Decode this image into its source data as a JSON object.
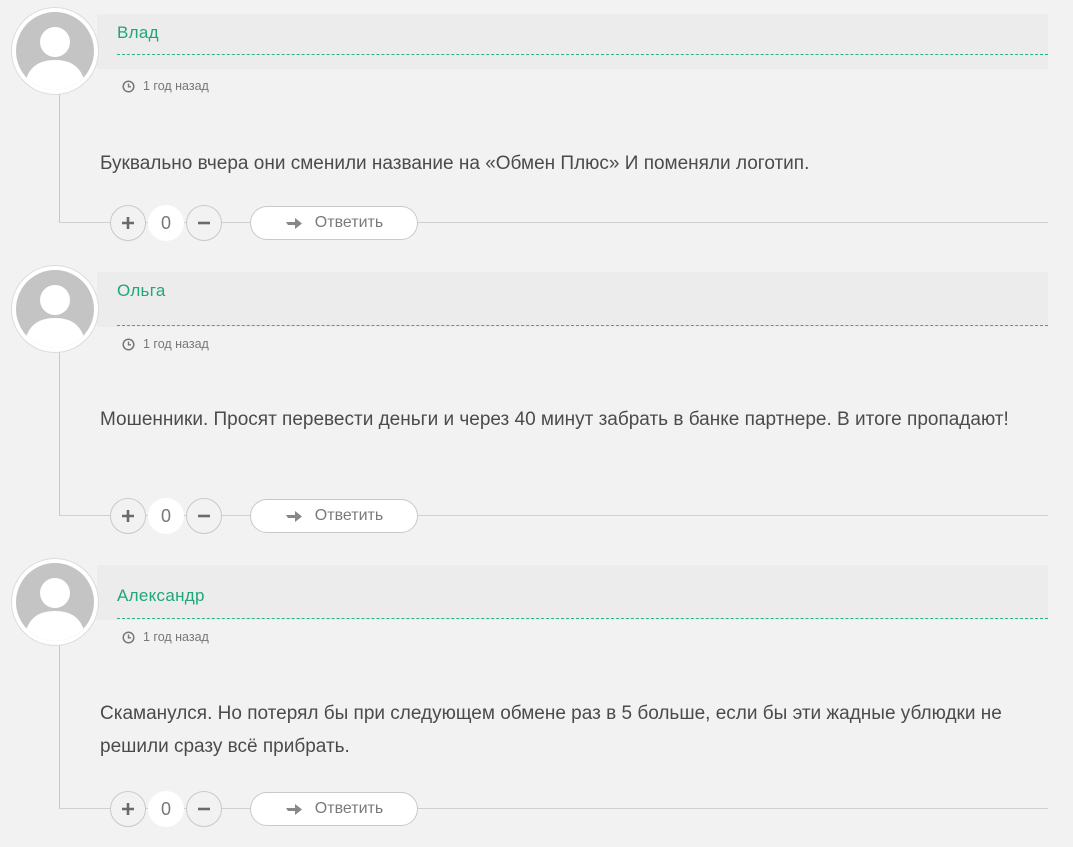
{
  "comments": [
    {
      "author": "Влад",
      "time": "1 год назад",
      "text": "Буквально вчера они сменили название на «Обмен Плюс» И поменяли логотип.",
      "votes": "0",
      "reply_label": "Ответить"
    },
    {
      "author": "Ольга",
      "time": "1 год назад",
      "text": "Мошенники. Просят перевести деньги и через 40 минут забрать в банке партнере. В итоге пропадают!",
      "votes": "0",
      "reply_label": "Ответить"
    },
    {
      "author": "Александр",
      "time": "1 год назад",
      "text": "Скаманулся. Но потерял бы при следующем обмене раз в 5 больше, если бы эти жадные ублюдки не решили сразу всё прибрать.",
      "votes": "0",
      "reply_label": "Ответить"
    }
  ],
  "icons": {
    "vote_up": "plus-icon",
    "vote_down": "minus-icon",
    "reply": "reply-arrow-icon",
    "time": "clock-icon",
    "avatar": "default-user-avatar"
  },
  "colors": {
    "author": "#1fa67a",
    "accent_dash": "#2bb389",
    "background": "#f2f2f2",
    "text": "#4b4b4b"
  }
}
